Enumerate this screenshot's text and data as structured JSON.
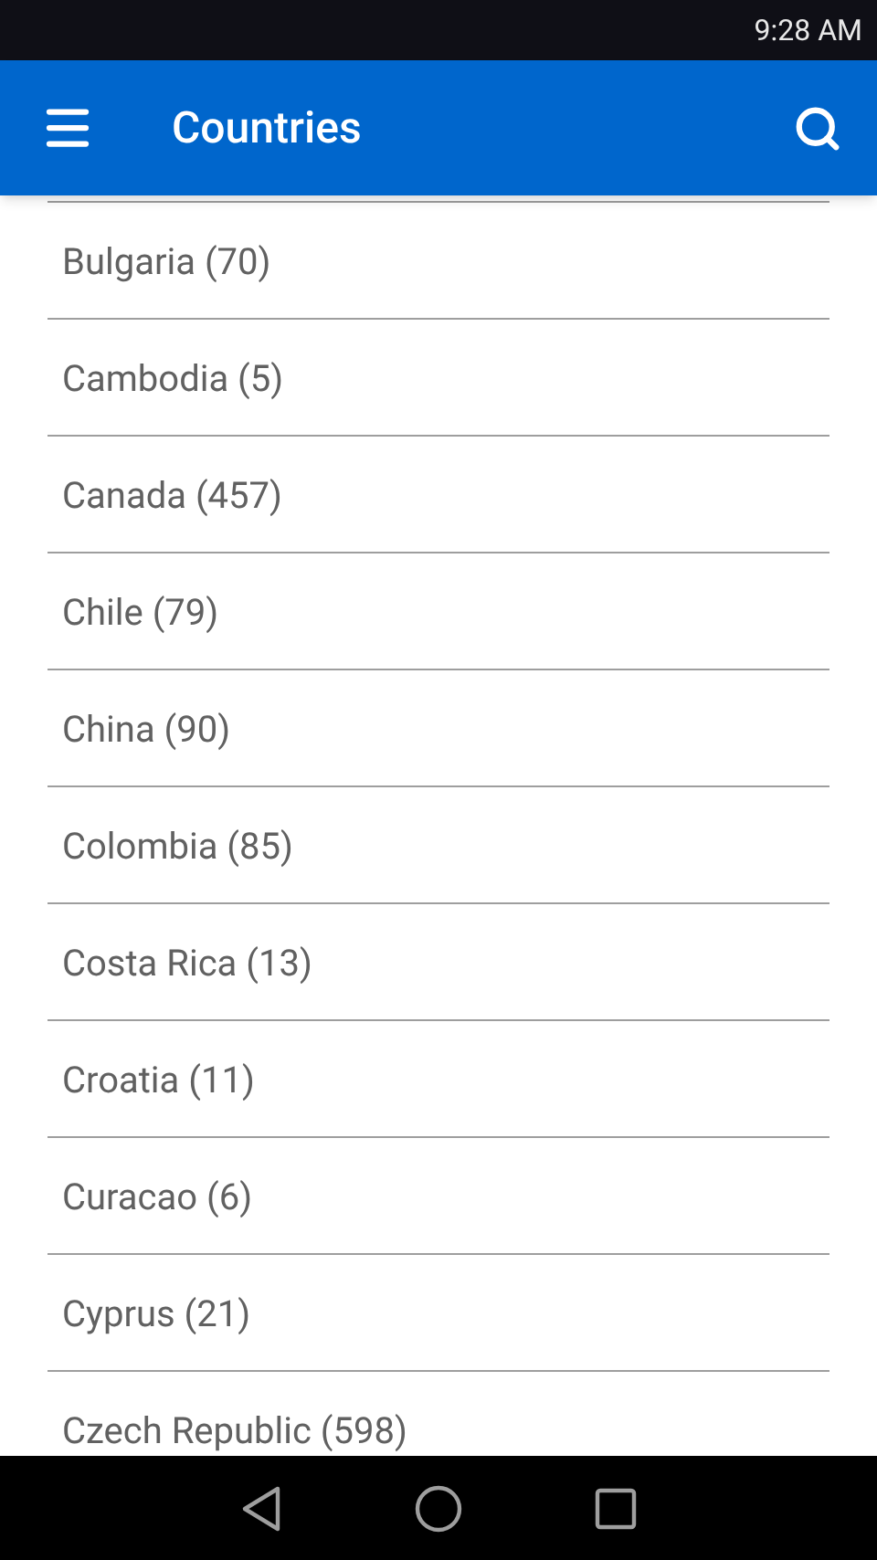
{
  "status_bar": {
    "time": "9:28 AM"
  },
  "app_bar": {
    "title": "Countries"
  },
  "countries": [
    {
      "label": "Bulgaria (70)"
    },
    {
      "label": "Cambodia (5)"
    },
    {
      "label": "Canada (457)"
    },
    {
      "label": "Chile (79)"
    },
    {
      "label": "China (90)"
    },
    {
      "label": "Colombia (85)"
    },
    {
      "label": "Costa Rica (13)"
    },
    {
      "label": "Croatia (11)"
    },
    {
      "label": "Curacao (6)"
    },
    {
      "label": "Cyprus (21)"
    },
    {
      "label": "Czech Republic (598)"
    }
  ]
}
